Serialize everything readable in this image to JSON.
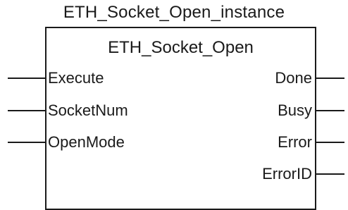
{
  "diagram": {
    "instance_name": "ETH_Socket_Open_instance",
    "block_type": "ETH_Socket_Open",
    "inputs": [
      {
        "label": "Execute"
      },
      {
        "label": "SocketNum"
      },
      {
        "label": "OpenMode"
      }
    ],
    "outputs": [
      {
        "label": "Done"
      },
      {
        "label": "Busy"
      },
      {
        "label": "Error"
      },
      {
        "label": "ErrorID"
      }
    ]
  }
}
